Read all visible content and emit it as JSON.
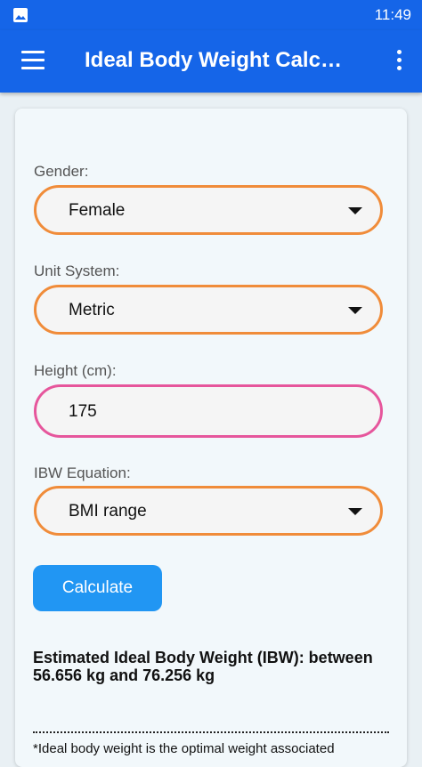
{
  "status_bar": {
    "time": "11:49",
    "notification_icon": "image-icon"
  },
  "app_bar": {
    "title": "Ideal Body Weight Calc…",
    "menu_icon": "hamburger-menu-icon",
    "more_icon": "more-vertical-icon"
  },
  "form": {
    "gender": {
      "label": "Gender:",
      "value": "Female"
    },
    "unit_system": {
      "label": "Unit System:",
      "value": "Metric"
    },
    "height": {
      "label": "Height (cm):",
      "value": "175"
    },
    "ibw_equation": {
      "label": "IBW Equation:",
      "value": "BMI range"
    },
    "calculate_label": "Calculate"
  },
  "result": {
    "text": "Estimated Ideal Body Weight (IBW): between 56.656 kg and 76.256 kg"
  },
  "footnote": {
    "text": "*Ideal body weight is the optimal weight associated"
  },
  "colors": {
    "primary": "#1565e8",
    "select_border": "#f08c3a",
    "input_border": "#e6569c",
    "button": "#2196f3"
  }
}
